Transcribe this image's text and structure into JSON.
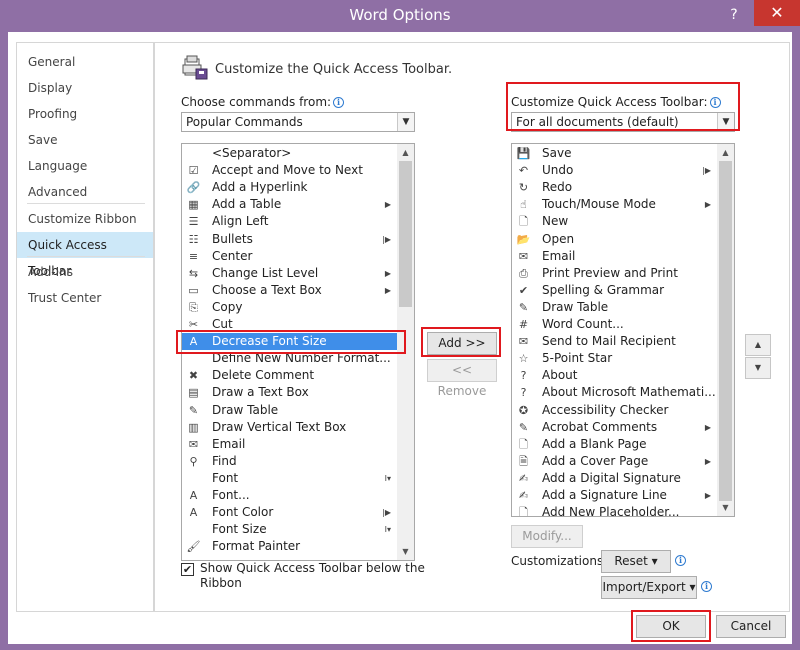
{
  "window": {
    "title": "Word Options",
    "help": "?",
    "close": "✕"
  },
  "nav": {
    "items": [
      {
        "label": "General"
      },
      {
        "label": "Display"
      },
      {
        "label": "Proofing"
      },
      {
        "label": "Save"
      },
      {
        "label": "Language"
      },
      {
        "label": "Advanced"
      },
      {
        "label": "Customize Ribbon"
      },
      {
        "label": "Quick Access Toolbar",
        "selected": true
      },
      {
        "label": "Add-Ins"
      },
      {
        "label": "Trust Center"
      }
    ]
  },
  "header": {
    "title": "Customize the Quick Access Toolbar."
  },
  "choose": {
    "label": "Choose commands from:",
    "value": "Popular Commands"
  },
  "customize": {
    "label": "Customize Quick Access Toolbar:",
    "value": "For all documents (default)"
  },
  "commands": [
    {
      "label": "<Separator>",
      "icon": ""
    },
    {
      "label": "Accept and Move to Next",
      "icon": "☑"
    },
    {
      "label": "Add a Hyperlink",
      "icon": "🔗"
    },
    {
      "label": "Add a Table",
      "icon": "▦",
      "submenu": "▶"
    },
    {
      "label": "Align Left",
      "icon": "☰"
    },
    {
      "label": "Bullets",
      "icon": "☷",
      "submenu": "|▶"
    },
    {
      "label": "Center",
      "icon": "≡"
    },
    {
      "label": "Change List Level",
      "icon": "⇆",
      "submenu": "▶"
    },
    {
      "label": "Choose a Text Box",
      "icon": "▭",
      "submenu": "▶"
    },
    {
      "label": "Copy",
      "icon": "⎘"
    },
    {
      "label": "Cut",
      "icon": "✂"
    },
    {
      "label": "Decrease Font Size",
      "icon": "A",
      "selected": true
    },
    {
      "label": "Define New Number Format...",
      "icon": ""
    },
    {
      "label": "Delete Comment",
      "icon": "✖"
    },
    {
      "label": "Draw a Text Box",
      "icon": "▤"
    },
    {
      "label": "Draw Table",
      "icon": "✎"
    },
    {
      "label": "Draw Vertical Text Box",
      "icon": "▥"
    },
    {
      "label": "Email",
      "icon": "✉"
    },
    {
      "label": "Find",
      "icon": "⚲"
    },
    {
      "label": "Font",
      "icon": "",
      "submenu": "I▾"
    },
    {
      "label": "Font...",
      "icon": "A"
    },
    {
      "label": "Font Color",
      "icon": "A",
      "submenu": "|▶"
    },
    {
      "label": "Font Size",
      "icon": "",
      "submenu": "I▾"
    },
    {
      "label": "Format Painter",
      "icon": "🖌"
    }
  ],
  "toolbar_commands": [
    {
      "label": "Save",
      "icon": "💾"
    },
    {
      "label": "Undo",
      "icon": "↶",
      "submenu": "|▶"
    },
    {
      "label": "Redo",
      "icon": "↻"
    },
    {
      "label": "Touch/Mouse Mode",
      "icon": "☝",
      "submenu": "▶"
    },
    {
      "label": "New",
      "icon": "🗋"
    },
    {
      "label": "Open",
      "icon": "📂"
    },
    {
      "label": "Email",
      "icon": "✉"
    },
    {
      "label": "Print Preview and Print",
      "icon": "⎙"
    },
    {
      "label": "Spelling & Grammar",
      "icon": "✔"
    },
    {
      "label": "Draw Table",
      "icon": "✎"
    },
    {
      "label": "Word Count...",
      "icon": "#"
    },
    {
      "label": "Send to Mail Recipient",
      "icon": "✉"
    },
    {
      "label": "5-Point Star",
      "icon": "☆"
    },
    {
      "label": "About",
      "icon": "?"
    },
    {
      "label": "About Microsoft Mathemati...",
      "icon": "?"
    },
    {
      "label": "Accessibility Checker",
      "icon": "✪"
    },
    {
      "label": "Acrobat Comments",
      "icon": "✎",
      "submenu": "▶"
    },
    {
      "label": "Add a Blank Page",
      "icon": "🗋"
    },
    {
      "label": "Add a Cover Page",
      "icon": "🗎",
      "submenu": "▶"
    },
    {
      "label": "Add a Digital Signature",
      "icon": "✍"
    },
    {
      "label": "Add a Signature Line",
      "icon": "✍",
      "submenu": "▶"
    },
    {
      "label": "Add New Placeholder...",
      "icon": "🗋"
    }
  ],
  "buttons": {
    "add": "Add >>",
    "remove": "<< Remove",
    "modify": "Modify...",
    "reset": "Reset ▾",
    "import_export": "Import/Export ▾",
    "ok": "OK",
    "cancel": "Cancel",
    "move_up": "▲",
    "move_down": "▼"
  },
  "customizations_label": "Customizations:",
  "show_below": {
    "label_line1": "Show Quick Access Toolbar below the",
    "label_line2": "Ribbon",
    "checked": "✔"
  },
  "colors": {
    "titlebar": "#8f6fa5",
    "close": "#c7362f",
    "selection": "#3f8ee9",
    "highlight": "#e0191e",
    "nav_selected": "#cde8f8"
  }
}
